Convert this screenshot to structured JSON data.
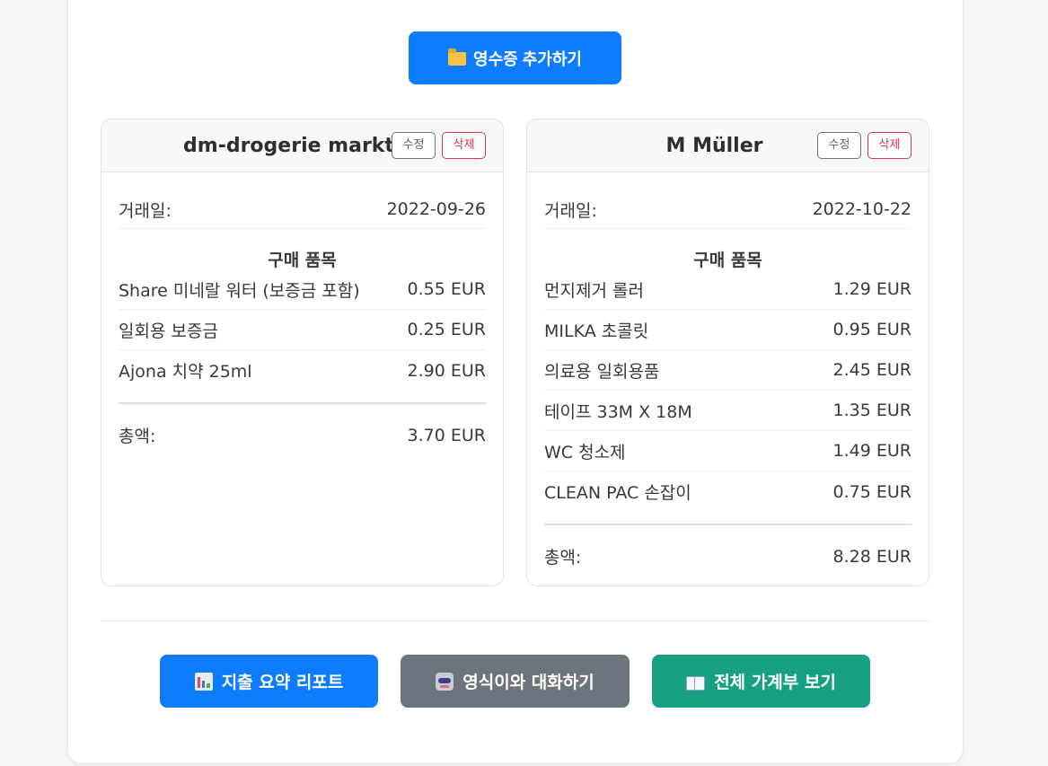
{
  "header": {
    "add_receipt_label": "영수증 추가하기",
    "add_receipt_icon": "folder-icon"
  },
  "receipts": [
    {
      "store": "dm-drogerie markt",
      "edit_label": "수정",
      "delete_label": "삭제",
      "date_label": "거래일:",
      "date": "2022-09-26",
      "items_title": "구매 품목",
      "items": [
        {
          "name": "Share 미네랄 워터 (보증금 포함)",
          "price": "0.55 EUR"
        },
        {
          "name": "일회용 보증금",
          "price": "0.25 EUR"
        },
        {
          "name": "Ajona 치약 25ml",
          "price": "2.90 EUR"
        }
      ],
      "total_label": "총액:",
      "total": "3.70 EUR"
    },
    {
      "store": "M Müller",
      "edit_label": "수정",
      "delete_label": "삭제",
      "date_label": "거래일:",
      "date": "2022-10-22",
      "items_title": "구매 품목",
      "items": [
        {
          "name": "먼지제거 롤러",
          "price": "1.29 EUR"
        },
        {
          "name": "MILKA 초콜릿",
          "price": "0.95 EUR"
        },
        {
          "name": "의료용 일회용품",
          "price": "2.45 EUR"
        },
        {
          "name": "테이프 33M X 18M",
          "price": "1.35 EUR"
        },
        {
          "name": "WC 청소제",
          "price": "1.49 EUR"
        },
        {
          "name": "CLEAN PAC 손잡이",
          "price": "0.75 EUR"
        }
      ],
      "total_label": "총액:",
      "total": "8.28 EUR"
    }
  ],
  "footer": {
    "report_label": "지출 요약 리포트",
    "report_icon": "bar-chart-icon",
    "chat_label": "영식이와 대화하기",
    "chat_icon": "robot-icon",
    "ledger_label": "전체 가계부 보기",
    "ledger_icon": "open-book-icon"
  },
  "colors": {
    "primary": "#0d7cff",
    "secondary": "#6c757d",
    "success": "#17a082",
    "danger": "#dc3545"
  }
}
